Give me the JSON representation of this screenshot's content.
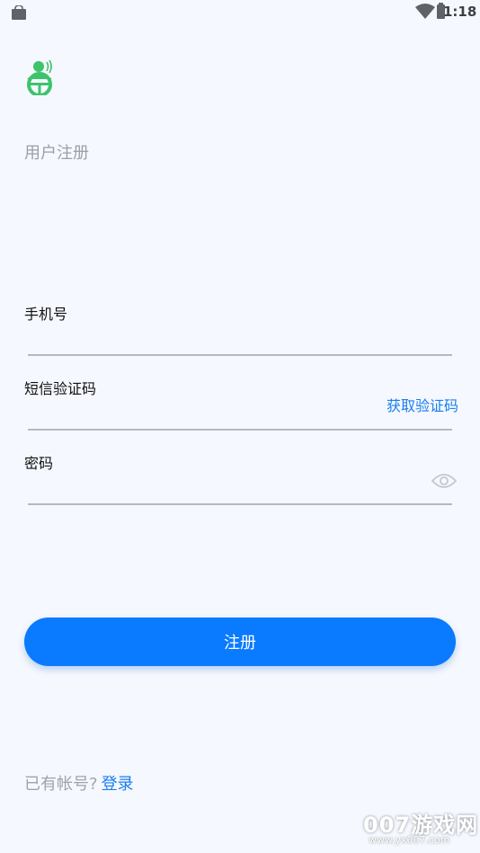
{
  "status_bar": {
    "time": "1:18",
    "left_icon": "shopping-bag-icon",
    "wifi_icon": "wifi-icon",
    "battery_icon": "battery-icon"
  },
  "logo": {
    "icon": "driver-steering-wheel-logo"
  },
  "page": {
    "title": "用户注册"
  },
  "form": {
    "phone": {
      "label": "手机号",
      "value": "",
      "placeholder": ""
    },
    "sms": {
      "label": "短信验证码",
      "value": "",
      "placeholder": "",
      "get_code_label": "获取验证码"
    },
    "password": {
      "label": "密码",
      "value": "",
      "placeholder": "",
      "eye_icon": "eye-icon"
    }
  },
  "register_button": {
    "label": "注册"
  },
  "footer": {
    "prompt": "已有帐号?",
    "login_label": "登录"
  },
  "watermark": {
    "main": "007游戏网",
    "sub": "www.yx007.com"
  },
  "colors": {
    "background": "#f5f8fe",
    "accent": "#0a7aff",
    "link": "#1a7ef0",
    "logo_green": "#3cc46a"
  }
}
